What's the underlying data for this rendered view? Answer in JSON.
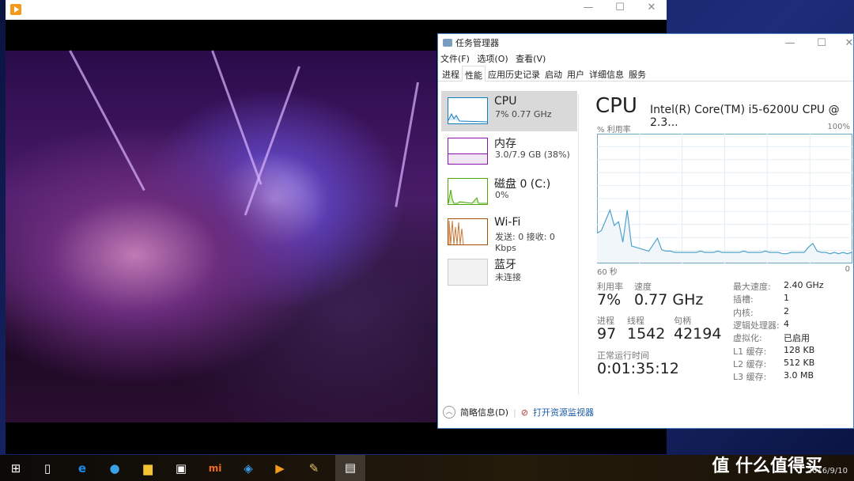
{
  "player": {
    "icon": "media-player-icon",
    "minimize": "—",
    "maximize": "☐",
    "close": "✕"
  },
  "taskmgr": {
    "title": "任务管理器",
    "menu": [
      "文件(F)",
      "选项(O)",
      "查看(V)"
    ],
    "tabs": [
      "进程",
      "性能",
      "应用历史记录",
      "启动",
      "用户",
      "详细信息",
      "服务"
    ],
    "active_tab": "性能",
    "sidebar": [
      {
        "name": "CPU",
        "sub": "7% 0.77 GHz",
        "color": "#117dbb"
      },
      {
        "name": "内存",
        "sub": "3.0/7.9 GB (38%)",
        "color": "#8b12ae"
      },
      {
        "name": "磁盘 0 (C:)",
        "sub": "0%",
        "color": "#4da60c"
      },
      {
        "name": "Wi-Fi",
        "sub": "发送: 0 接收: 0 Kbps",
        "color": "#a74f01"
      },
      {
        "name": "蓝牙",
        "sub": "未连接",
        "color": "#999999"
      }
    ],
    "header": {
      "title": "CPU",
      "model": "Intel(R) Core(TM) i5-6200U CPU @ 2.3..."
    },
    "graph": {
      "ylabel": "% 利用率",
      "ymax": "100%",
      "xleft": "60 秒",
      "xright": "0",
      "values": [
        23,
        25,
        33,
        41,
        29,
        32,
        16,
        41,
        13,
        12,
        11,
        10,
        9,
        14,
        19,
        10,
        9,
        9,
        8,
        8,
        8,
        8,
        8,
        8,
        9,
        8,
        8,
        8,
        9,
        8,
        8,
        8,
        8,
        8,
        9,
        8,
        8,
        8,
        8,
        9,
        8,
        8,
        8,
        7,
        7,
        8,
        8,
        8,
        8,
        12,
        15,
        9,
        8,
        8,
        7,
        8,
        7,
        8,
        7,
        8
      ]
    },
    "stats": {
      "util_label": "利用率",
      "util": "7%",
      "speed_label": "速度",
      "speed": "0.77 GHz",
      "proc_label": "进程",
      "proc": "97",
      "thread_label": "线程",
      "thread": "1542",
      "handle_label": "句柄",
      "handle": "42194",
      "uptime_label": "正常运行时间",
      "uptime": "0:01:35:12"
    },
    "specs": [
      {
        "k": "最大速度:",
        "v": "2.40 GHz"
      },
      {
        "k": "插槽:",
        "v": "1"
      },
      {
        "k": "内核:",
        "v": "2"
      },
      {
        "k": "逻辑处理器:",
        "v": "4"
      },
      {
        "k": "虚拟化:",
        "v": "已启用"
      },
      {
        "k": "L1 缓存:",
        "v": "128 KB"
      },
      {
        "k": "L2 缓存:",
        "v": "512 KB"
      },
      {
        "k": "L3 缓存:",
        "v": "3.0 MB"
      }
    ],
    "footer": {
      "brief": "简略信息(D)",
      "monitor": "打开资源监视器"
    }
  },
  "taskbar": {
    "date": "2016/9/10",
    "watermark": "值 什么值得买"
  }
}
